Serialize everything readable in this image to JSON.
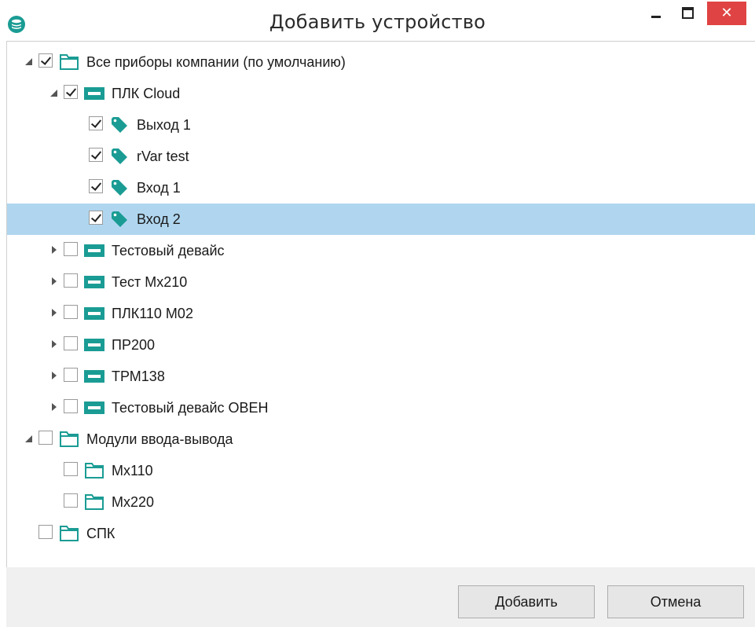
{
  "window": {
    "title": "Добавить устройство",
    "close_glyph": "✕",
    "accent": "#e04343"
  },
  "tree": {
    "selected_color": "#b0d6ef",
    "icon_color": "#1a9c94",
    "items": [
      {
        "label": "Все приборы компании (по умолчанию)",
        "level": 0,
        "type": "folder",
        "checked": true,
        "expander": "expanded",
        "selected": false
      },
      {
        "label": "ПЛК Cloud",
        "level": 1,
        "type": "device",
        "checked": true,
        "expander": "expanded",
        "selected": false
      },
      {
        "label": "Выход 1",
        "level": 2,
        "type": "tag",
        "checked": true,
        "expander": "none",
        "selected": false
      },
      {
        "label": "rVar test",
        "level": 2,
        "type": "tag",
        "checked": true,
        "expander": "none",
        "selected": false
      },
      {
        "label": "Вход 1",
        "level": 2,
        "type": "tag",
        "checked": true,
        "expander": "none",
        "selected": false
      },
      {
        "label": "Вход 2",
        "level": 2,
        "type": "tag",
        "checked": true,
        "expander": "none",
        "selected": true
      },
      {
        "label": "Тестовый девайс",
        "level": 1,
        "type": "device",
        "checked": false,
        "expander": "collapsed",
        "selected": false
      },
      {
        "label": "Тест Мх210",
        "level": 1,
        "type": "device",
        "checked": false,
        "expander": "collapsed",
        "selected": false
      },
      {
        "label": "ПЛК110 М02",
        "level": 1,
        "type": "device",
        "checked": false,
        "expander": "collapsed",
        "selected": false
      },
      {
        "label": "ПР200",
        "level": 1,
        "type": "device",
        "checked": false,
        "expander": "collapsed",
        "selected": false
      },
      {
        "label": "ТРМ138",
        "level": 1,
        "type": "device",
        "checked": false,
        "expander": "collapsed",
        "selected": false
      },
      {
        "label": "Тестовый девайс ОВЕН",
        "level": 1,
        "type": "device",
        "checked": false,
        "expander": "collapsed",
        "selected": false
      },
      {
        "label": "Модули ввода-вывода",
        "level": 0,
        "type": "folder",
        "checked": false,
        "expander": "expanded",
        "selected": false
      },
      {
        "label": "Мх110",
        "level": 1,
        "type": "folder",
        "checked": false,
        "expander": "none",
        "selected": false
      },
      {
        "label": "Мх220",
        "level": 1,
        "type": "folder",
        "checked": false,
        "expander": "none",
        "selected": false
      },
      {
        "label": "СПК",
        "level": 0,
        "type": "folder",
        "checked": false,
        "expander": "none",
        "selected": false
      }
    ]
  },
  "buttons": {
    "add_label": "Добавить",
    "cancel_label": "Отмена"
  }
}
